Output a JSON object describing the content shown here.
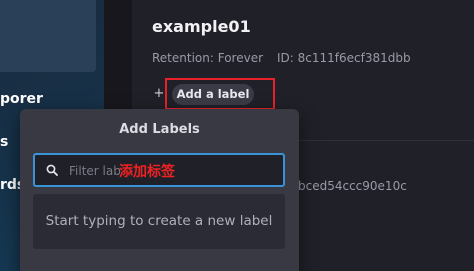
{
  "sidebar": {
    "items": [
      {
        "label": "porer"
      },
      {
        "label": "s"
      },
      {
        "label": "rds"
      }
    ]
  },
  "bucket": {
    "name": "example01",
    "retention": "Retention: Forever",
    "id": "ID: 8c111f6ecf381dbb"
  },
  "labels": {
    "add_button": "Add a label",
    "adder_icon": "+"
  },
  "background": {
    "partial_id": "bced54ccc90e10c"
  },
  "popover": {
    "title": "Add Labels",
    "filter_placeholder": "Filter lab",
    "annotation": "添加标签",
    "empty_state": "Start typing to create a new label"
  },
  "colors": {
    "accent": "#3a93d6",
    "annotation": "#ee2222"
  }
}
